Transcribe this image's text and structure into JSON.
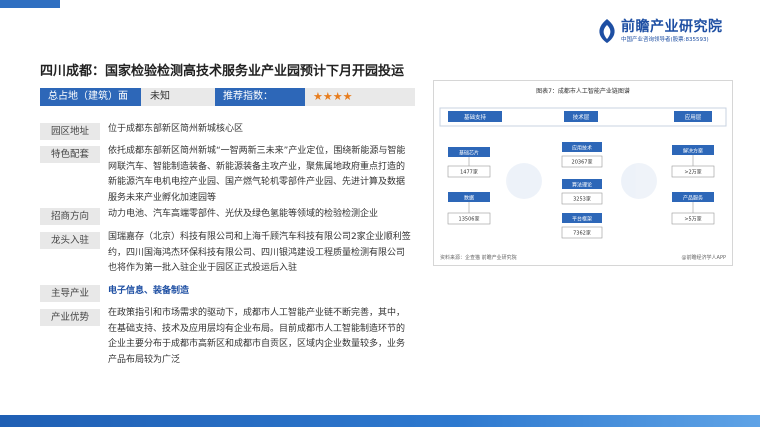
{
  "logo": {
    "title": "前瞻产业研究院",
    "subtitle": "中国产业咨询领导者(股票:835593)"
  },
  "title": "四川成都：国家检验检测高技术服务业产业园预计下月开园投运",
  "summary": {
    "area_label": "总占地（建筑）面积：",
    "area_value": "未知",
    "rating_label": "推荐指数：",
    "rating_stars": "★★★★",
    "rating_value": 4
  },
  "rows": [
    {
      "label": "园区地址",
      "text": "位于成都东部新区简州新城核心区"
    },
    {
      "label": "特色配套",
      "text": "依托成都东部新区简州新城“一智两新三未来”产业定位，围绕新能源与智能网联汽车、智能制造装备、新能源装备主攻产业，聚焦属地政府重点打造的新能源汽车电机电控产业园、国产燃气轮机零部件产业园、先进计算及数据服务未来产业孵化加速园等"
    },
    {
      "label": "招商方向",
      "text": "动力电池、汽车高端零部件、光伏及绿色氢能等领域的检验检测企业"
    },
    {
      "label": "龙头入驻",
      "text": "国瑞嘉存（北京）科技有限公司和上海千顾汽车科技有限公司2家企业顺利签约，四川国海鸿杰环保科技有限公司、四川银鸿建设工程质量检测有限公司也将作为第一批入驻企业于园区正式投运后入驻"
    },
    {
      "label": "主导产业",
      "text": "电子信息、装备制造"
    },
    {
      "label": "产业优势",
      "text": "在政策指引和市场需求的驱动下，成都市人工智能产业链不断完善，其中，在基础支持、技术及应用层均有企业布局。目前成都市人工智能制造环节的企业主要分布于成都市高新区和成都市自贡区，区域内企业数量较多，业务产品布局较为广泛"
    }
  ],
  "figure": {
    "title": "图表7：成都市人工智能产业链图谱",
    "layers": [
      "基础支持",
      "技术层",
      "应用层"
    ],
    "left_items": [
      {
        "name": "基础芯片",
        "count": "1477家"
      },
      {
        "name": "数据",
        "count": "13506家"
      }
    ],
    "mid_items": [
      {
        "name": "应用技术",
        "count": "20367家"
      },
      {
        "name": "算法理论",
        "count": "3253家"
      },
      {
        "name": "平台框架",
        "count": "7362家"
      }
    ],
    "right_items": [
      {
        "name": "解决方案",
        "count": ">2万家"
      },
      {
        "name": "产品服务",
        "count": ">5万家"
      }
    ],
    "source": "资料来源：企查猫 前瞻产业研究院",
    "brand": "@前瞻经济学人APP"
  }
}
